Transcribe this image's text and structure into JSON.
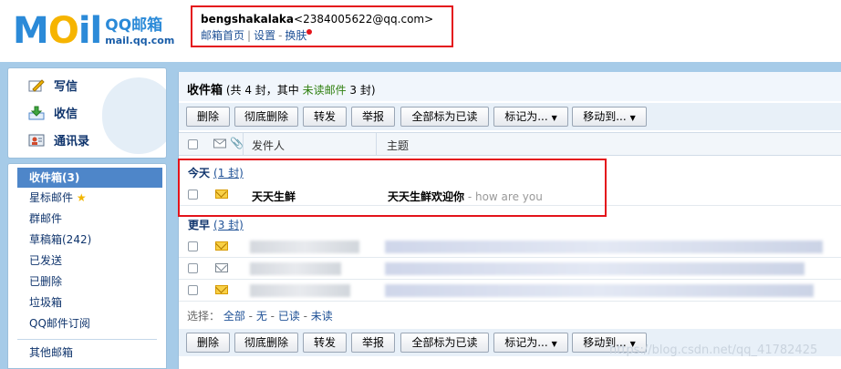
{
  "header": {
    "logo_word": "MOil",
    "logo_cn": "QQ邮箱",
    "logo_url": "mail.qq.com",
    "username": "bengshakalaka",
    "email": "<2384005622@qq.com>",
    "links": [
      "邮箱首页",
      "设置",
      "换肤"
    ]
  },
  "sidebar": {
    "actions": [
      {
        "label": "写信",
        "icon": "compose-icon"
      },
      {
        "label": "收信",
        "icon": "receive-icon"
      },
      {
        "label": "通讯录",
        "icon": "contacts-icon"
      }
    ],
    "folders": [
      {
        "label": "收件箱(3)"
      },
      {
        "label": "星标邮件"
      },
      {
        "label": "群邮件"
      },
      {
        "label": "草稿箱(242)"
      },
      {
        "label": "已发送"
      },
      {
        "label": "已删除"
      },
      {
        "label": "垃圾箱"
      },
      {
        "label": "QQ邮件订阅"
      }
    ],
    "other": "其他邮箱"
  },
  "main": {
    "title": "收件箱",
    "summary_prefix": " (共 4 封，其中 ",
    "unread_label": "未读邮件",
    "summary_suffix": " 3 封)",
    "toolbar": [
      "删除",
      "彻底删除",
      "转发",
      "举报",
      "全部标为已读",
      "标记为...",
      "移动到..."
    ],
    "columns": {
      "sender": "发件人",
      "subject": "主题"
    },
    "groups": [
      {
        "title": "今天",
        "count": "(1 封)"
      },
      {
        "title": "更早",
        "count": "(3 封)"
      }
    ],
    "today_row": {
      "sender": "天天生鲜",
      "subject": "天天生鲜欢迎你",
      "preview": " - how are you"
    },
    "select_bar": {
      "label": "选择：",
      "all": "全部",
      "none": "无",
      "read": "已读",
      "unread": "未读"
    }
  },
  "watermark": "https://blog.csdn.net/qq_41782425"
}
